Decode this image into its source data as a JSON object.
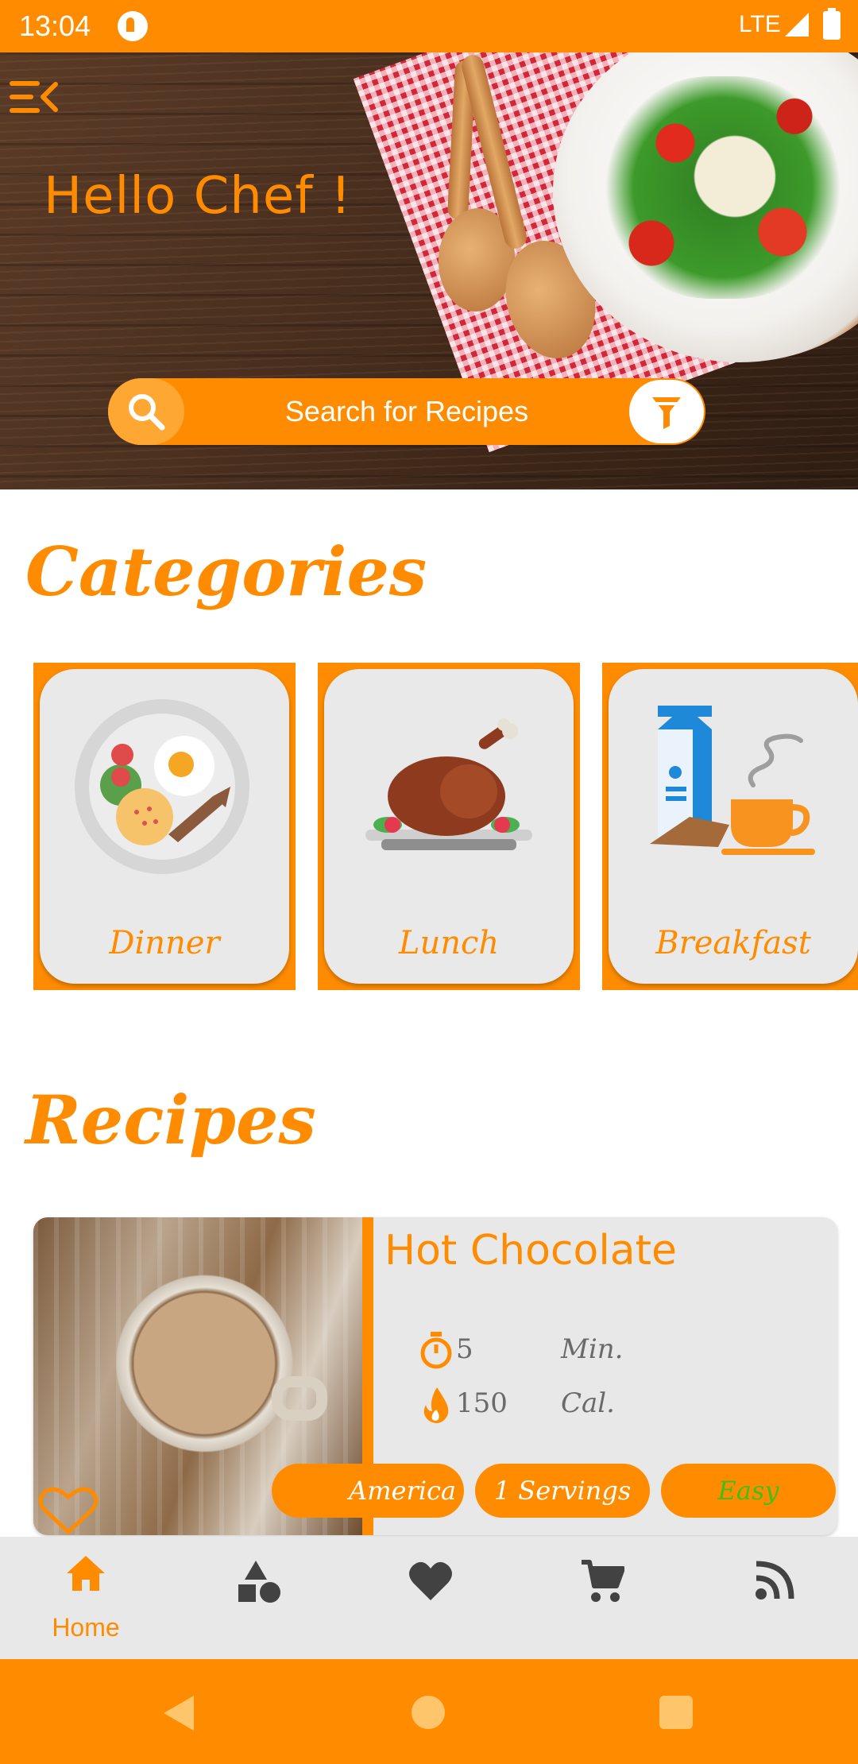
{
  "status_bar": {
    "time": "13:04",
    "network": "LTE"
  },
  "hero": {
    "greeting": "Hello Chef !"
  },
  "search": {
    "placeholder": "Search for Recipes"
  },
  "categories": {
    "title": "Categories",
    "items": [
      {
        "label": "Dinner",
        "icon": "dinner-plate-icon"
      },
      {
        "label": "Lunch",
        "icon": "roast-chicken-icon"
      },
      {
        "label": "Breakfast",
        "icon": "milk-coffee-icon"
      }
    ]
  },
  "recipes": {
    "title": "Recipes",
    "items": [
      {
        "name": "Hot Chocolate",
        "time_value": "5",
        "time_unit": "Min.",
        "calories_value": "150",
        "calories_unit": "Cal.",
        "cuisine": "America",
        "servings": "1 Servings",
        "difficulty": "Easy"
      }
    ]
  },
  "bottom_nav": {
    "items": [
      {
        "label": "Home",
        "icon": "home-icon",
        "active": true
      },
      {
        "label": "",
        "icon": "categories-icon"
      },
      {
        "label": "",
        "icon": "favorites-heart-icon"
      },
      {
        "label": "",
        "icon": "cart-icon"
      },
      {
        "label": "",
        "icon": "rss-feed-icon"
      }
    ]
  },
  "colors": {
    "accent": "#FF8C00",
    "card_bg": "#E9E9E9",
    "easy_text": "#3FBF1A"
  }
}
